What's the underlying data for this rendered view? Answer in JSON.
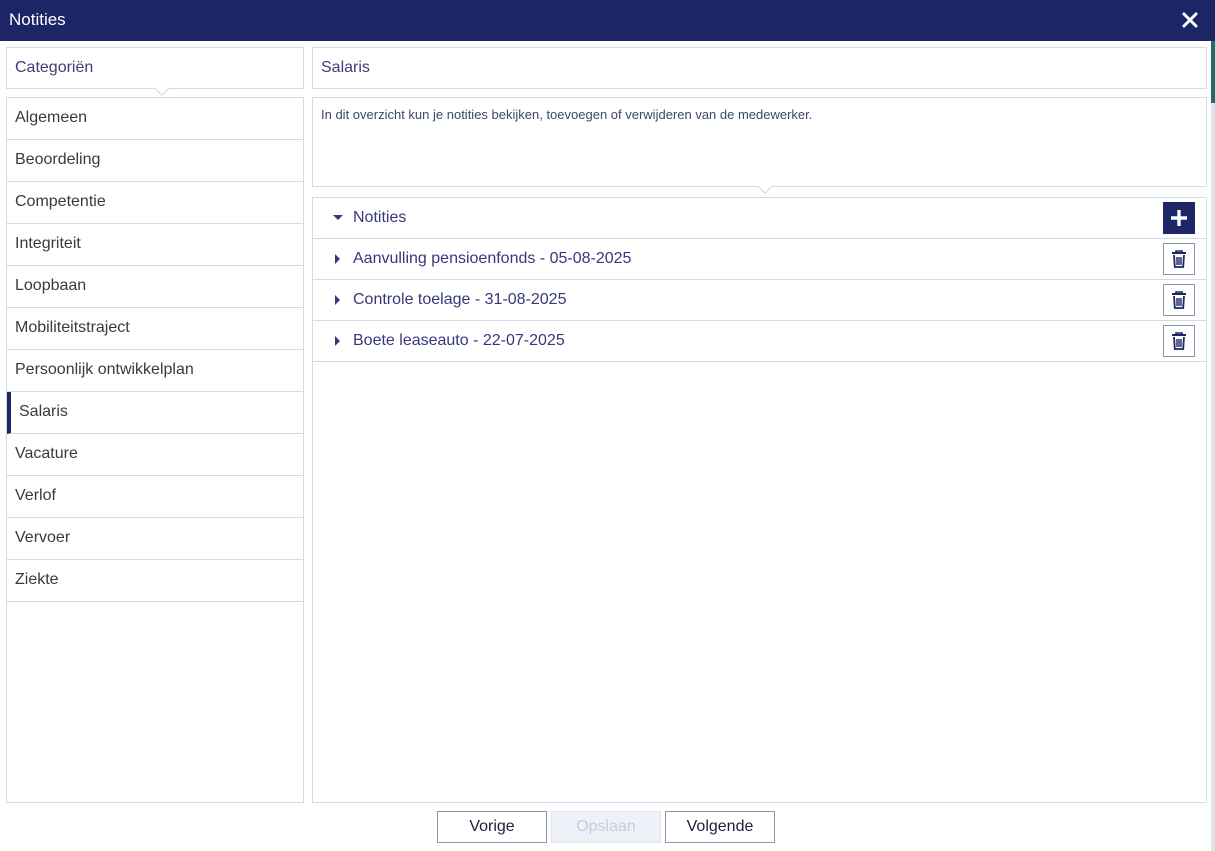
{
  "window": {
    "title": "Notities"
  },
  "categories": {
    "header": "Categoriën",
    "items": [
      {
        "label": "Algemeen"
      },
      {
        "label": "Beoordeling"
      },
      {
        "label": "Competentie"
      },
      {
        "label": "Integriteit"
      },
      {
        "label": "Loopbaan"
      },
      {
        "label": "Mobiliteitstraject"
      },
      {
        "label": "Persoonlijk ontwikkelplan"
      },
      {
        "label": "Salaris",
        "active": true
      },
      {
        "label": "Vacature"
      },
      {
        "label": "Verlof"
      },
      {
        "label": "Vervoer"
      },
      {
        "label": "Ziekte"
      }
    ]
  },
  "main": {
    "header": "Salaris",
    "description": "In dit overzicht kun je notities bekijken, toevoegen of verwijderen van de medewerker.",
    "notes": {
      "title": "Notities",
      "add_icon": "plus-icon",
      "items": [
        {
          "label": "Aanvulling pensioenfonds - 05-08-2025"
        },
        {
          "label": "Controle toelage - 31-08-2025"
        },
        {
          "label": "Boete leaseauto - 22-07-2025"
        }
      ],
      "delete_icon": "trash-icon"
    }
  },
  "footer": {
    "prev_label": "Vorige",
    "save_label": "Opslaan",
    "next_label": "Volgende"
  },
  "colors": {
    "accent": "#1c2565",
    "border": "#d6dbe2",
    "link_text": "#36387a"
  }
}
